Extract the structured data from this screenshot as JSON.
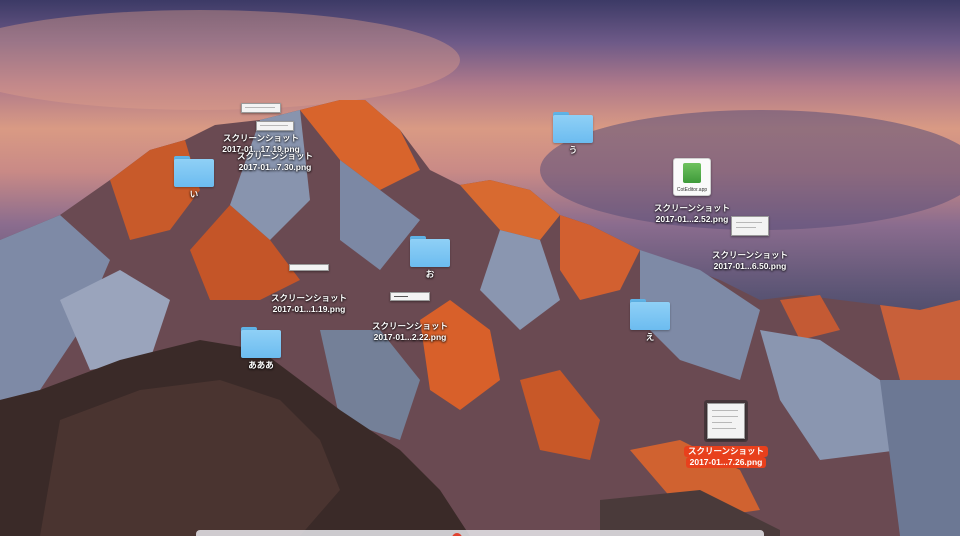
{
  "desktop": {
    "icons": [
      {
        "kind": "folder",
        "label": "い"
      },
      {
        "kind": "folder",
        "label": "う"
      },
      {
        "kind": "folder",
        "label": "お"
      },
      {
        "kind": "folder",
        "label": "え"
      },
      {
        "kind": "folder",
        "label": "あああ"
      },
      {
        "kind": "screenshot",
        "label_line1": "スクリーンショット",
        "label_line2": "2017-01...17.19.png"
      },
      {
        "kind": "screenshot",
        "label_line1": "スクリーンショット",
        "label_line2": "2017-01...7.30.png"
      },
      {
        "kind": "screenshot",
        "label_line1": "スクリーンショット",
        "label_line2": "2017-01...1.19.png"
      },
      {
        "kind": "screenshot",
        "label_line1": "スクリーンショット",
        "label_line2": "2017-01...2.22.png"
      },
      {
        "kind": "app",
        "app_caption": "CotEditor.app",
        "label_line1": "スクリーンショット",
        "label_line2": "2017-01...2.52.png"
      },
      {
        "kind": "screenshot",
        "label_line1": "スクリーンショット",
        "label_line2": "2017-01...6.50.png"
      },
      {
        "kind": "screenshot",
        "selected": true,
        "label_line1": "スクリーンショット",
        "label_line2": "2017-01...7.26.png"
      }
    ]
  },
  "colors": {
    "folder": "#6cbcf0",
    "selection": "#e8401c",
    "label_text": "#ffffff"
  }
}
